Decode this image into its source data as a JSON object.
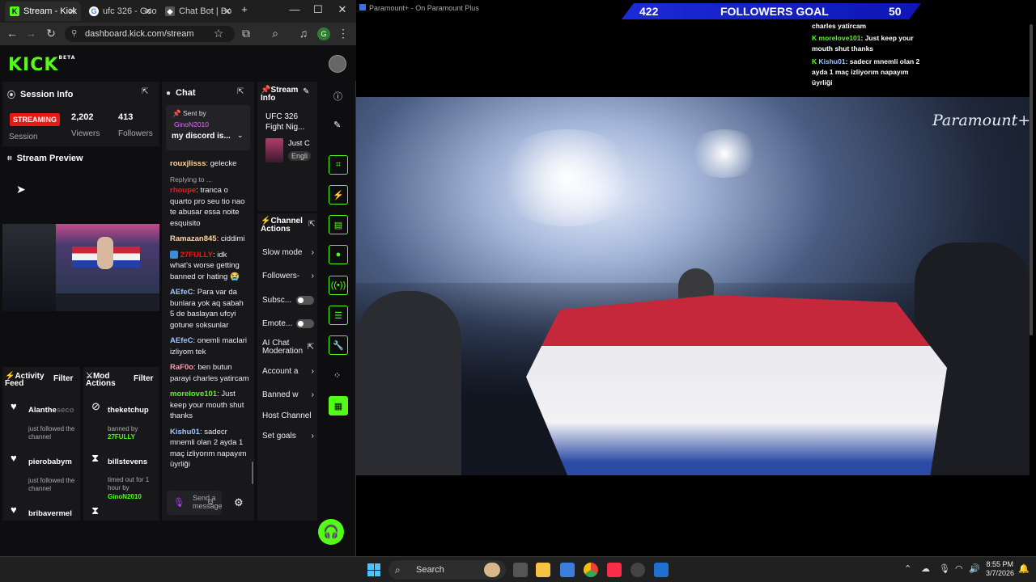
{
  "browser": {
    "tabs": [
      {
        "title": "Stream - Kick",
        "icon": "kick-icon"
      },
      {
        "title": "ufc 326 - Goo",
        "icon": "google-icon"
      },
      {
        "title": "Chat Bot | Bo",
        "icon": "botrix-icon"
      }
    ],
    "url": "dashboard.kick.com/stream",
    "profile_letter": "G"
  },
  "kick": {
    "logo": "KICK",
    "logo_sup": "BETA",
    "session": {
      "title": "Session Info",
      "status": "STREAMING",
      "status_label": "Session",
      "viewers": "2,202",
      "viewers_label": "Viewers",
      "followers": "413",
      "followers_label": "Followers"
    },
    "preview": {
      "title": "Stream Preview"
    },
    "chat": {
      "title": "Chat",
      "pinned_by_label": "Sent by",
      "pinned_user": "GinoN2010",
      "pinned_text": "my discord is...",
      "messages": [
        {
          "user": "rouxjlisss",
          "color": "#ffd59c",
          "text": ": gelecke"
        },
        {
          "reply": "Replying to ...",
          "user": "rhoupe",
          "color": "#e91916",
          "text": ": tranca o quarto pro seu tio nao te abusar essa noite esquisito"
        },
        {
          "user": "Ramazan845",
          "color": "#ffd59c",
          "text": ": ciddimi"
        },
        {
          "user": "27FULLY",
          "color": "#e91916",
          "text": ": idk what's worse getting banned or hating 😭"
        },
        {
          "user": "AEfeC",
          "color": "#9fc5ff",
          "text": ": Para var da bunlara yok aq sabah 5 de baslayan ufcyi gotune soksunlar"
        },
        {
          "user": "AEfeC",
          "color": "#9fc5ff",
          "text": ": onemli maclari izliyom tek"
        },
        {
          "user": "RaF0o",
          "color": "#ff9aa8",
          "text": ": ben butun parayi charles yatircam"
        },
        {
          "user": "morelove101",
          "color": "#53fc18",
          "text": ": Just keep your mouth shut thanks"
        },
        {
          "user": "Kishu01",
          "color": "#9fc5ff",
          "text": ": sadecr mnemli olan 2 ayda 1 maç izliyorım napayım üyrliği"
        }
      ],
      "input_placeholder": "Send a message"
    },
    "stream_info": {
      "title": "Stream Info",
      "stream_title": "UFC 326 Fight Nig...",
      "category": "Just C",
      "language": "Engli"
    },
    "channel_actions": {
      "title": "Channel Actions",
      "items": [
        {
          "label": "Slow mode",
          "type": "chevron"
        },
        {
          "label": "Followers-",
          "type": "chevron"
        },
        {
          "label": "Subsc...",
          "type": "toggle"
        },
        {
          "label": "Emote...",
          "type": "toggle"
        },
        {
          "label": "AI Chat Moderation",
          "type": "link"
        },
        {
          "label": "Account a",
          "type": "chevron"
        },
        {
          "label": "Banned w",
          "type": "chevron"
        },
        {
          "label": "Host Channel",
          "type": "none"
        },
        {
          "label": "Set goals",
          "type": "chevron"
        }
      ]
    },
    "activity": {
      "title": "Activity Feed",
      "filter": "Filter",
      "items": [
        {
          "user": "Alanthe",
          "user_faded": "seco",
          "text": "just followed the channel"
        },
        {
          "user": "pierobabym",
          "text": "just followed the channel"
        },
        {
          "user": "bribavermel",
          "text": ""
        }
      ]
    },
    "mod": {
      "title": "Mod Actions",
      "filter": "Filter",
      "items": [
        {
          "user": "theketchup",
          "action": "banned by",
          "by": "27FULLY"
        },
        {
          "user": "billstevens",
          "action": "timed out for 1 hour by",
          "by": "GinoN2010"
        }
      ]
    }
  },
  "stream_view": {
    "window_title": "Paramount+ - On Paramount Plus",
    "goal": {
      "current": "422",
      "label": "FOLLOWERS GOAL",
      "target": "50"
    },
    "watermark": "Paramount+",
    "overlay_chat": [
      {
        "user": "",
        "text": "charles yatircam"
      },
      {
        "user": "morelove101",
        "text": ": Just keep your mouth shut thanks"
      },
      {
        "user": "Kishu01",
        "text": ": sadecr mnemli olan 2 ayda 1 maç izliyorım napayım üyrliği"
      }
    ]
  },
  "taskbar": {
    "search": "Search",
    "time": "8:55 PM",
    "date": "3/7/2026"
  },
  "colors": {
    "kick_green": "#53fc18",
    "goal_blue": "#1c2bd8",
    "streaming_red": "#e91916"
  }
}
